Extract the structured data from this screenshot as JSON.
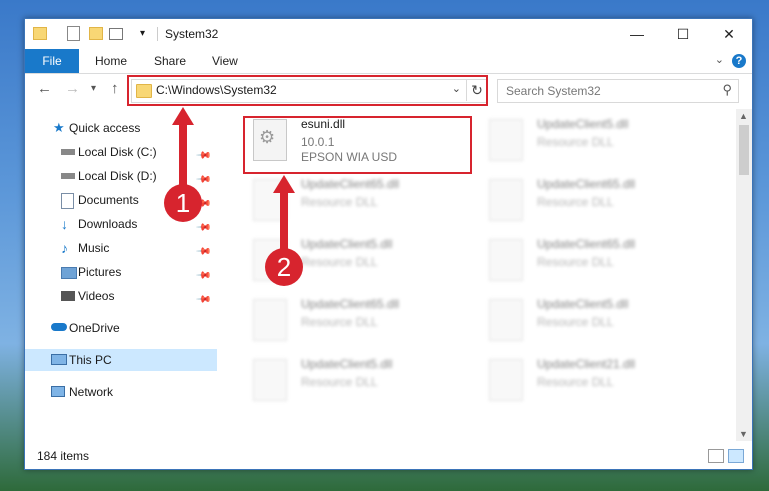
{
  "window": {
    "title": "System32"
  },
  "ribbon": {
    "tabs": [
      "File",
      "Home",
      "Share",
      "View"
    ]
  },
  "nav": {
    "path": "C:\\Windows\\System32",
    "search_placeholder": "Search System32"
  },
  "sidebar": {
    "items": [
      {
        "label": "Quick access",
        "icon": "star-icon"
      },
      {
        "label": "Local Disk (C:)",
        "icon": "drive-icon"
      },
      {
        "label": "Local Disk (D:)",
        "icon": "drive-icon"
      },
      {
        "label": "Documents",
        "icon": "documents-icon"
      },
      {
        "label": "Downloads",
        "icon": "download-icon"
      },
      {
        "label": "Music",
        "icon": "music-icon"
      },
      {
        "label": "Pictures",
        "icon": "pictures-icon"
      },
      {
        "label": "Videos",
        "icon": "videos-icon"
      },
      {
        "label": "OneDrive",
        "icon": "cloud-icon"
      },
      {
        "label": "This PC",
        "icon": "computer-icon"
      },
      {
        "label": "Network",
        "icon": "network-icon"
      }
    ]
  },
  "files": [
    {
      "name": "esuni.dll",
      "version": "10.0.1",
      "description": "EPSON WIA USD"
    },
    {
      "name": "UpdateClient5.dll",
      "description": "Resource DLL"
    },
    {
      "name": "UpdateClient65.dll",
      "description": "Resource DLL"
    },
    {
      "name": "UpdateClient65.dll",
      "description": "Resource DLL"
    },
    {
      "name": "UpdateClient5.dll",
      "description": "Resource DLL"
    },
    {
      "name": "UpdateClient65.dll",
      "description": "Resource DLL"
    },
    {
      "name": "UpdateClient65.dll",
      "description": "Resource DLL"
    },
    {
      "name": "UpdateClient5.dll",
      "description": "Resource DLL"
    },
    {
      "name": "UpdateClient5.dll",
      "description": "Resource DLL"
    },
    {
      "name": "UpdateClient21.dll",
      "description": "Resource DLL"
    }
  ],
  "status": {
    "items": "184 items"
  },
  "callouts": [
    "1",
    "2"
  ],
  "colors": {
    "accent": "#1979ca",
    "highlight": "#d7242e",
    "selection": "#cce8ff"
  }
}
